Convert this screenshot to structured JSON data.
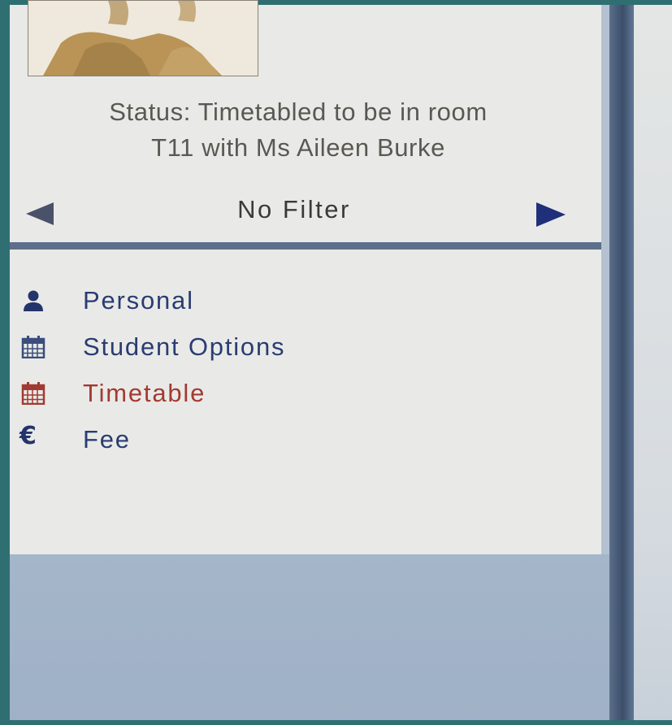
{
  "status": {
    "line1": "Status: Timetabled to be in room",
    "line2": "T11 with Ms Aileen Burke"
  },
  "filter": {
    "label": "No Filter",
    "prev_icon": "arrow-left-icon",
    "next_icon": "arrow-right-icon"
  },
  "menu": {
    "items": [
      {
        "label": "Personal",
        "icon": "person-icon",
        "color": "#2a3c72",
        "active": false
      },
      {
        "label": "Student Options",
        "icon": "calendar-icon",
        "color": "#2a3c72",
        "active": false
      },
      {
        "label": "Timetable",
        "icon": "calendar-icon",
        "color": "#a33a32",
        "active": true
      },
      {
        "label": "Fee",
        "icon": "euro-icon",
        "color": "#2a3c72",
        "active": false
      }
    ]
  },
  "colors": {
    "panel_bg": "#e9eae7",
    "status_text": "#5a5852",
    "nav_blue": "#1f2f7a",
    "active_red": "#a33a32",
    "divider": "#5d6f8a"
  }
}
